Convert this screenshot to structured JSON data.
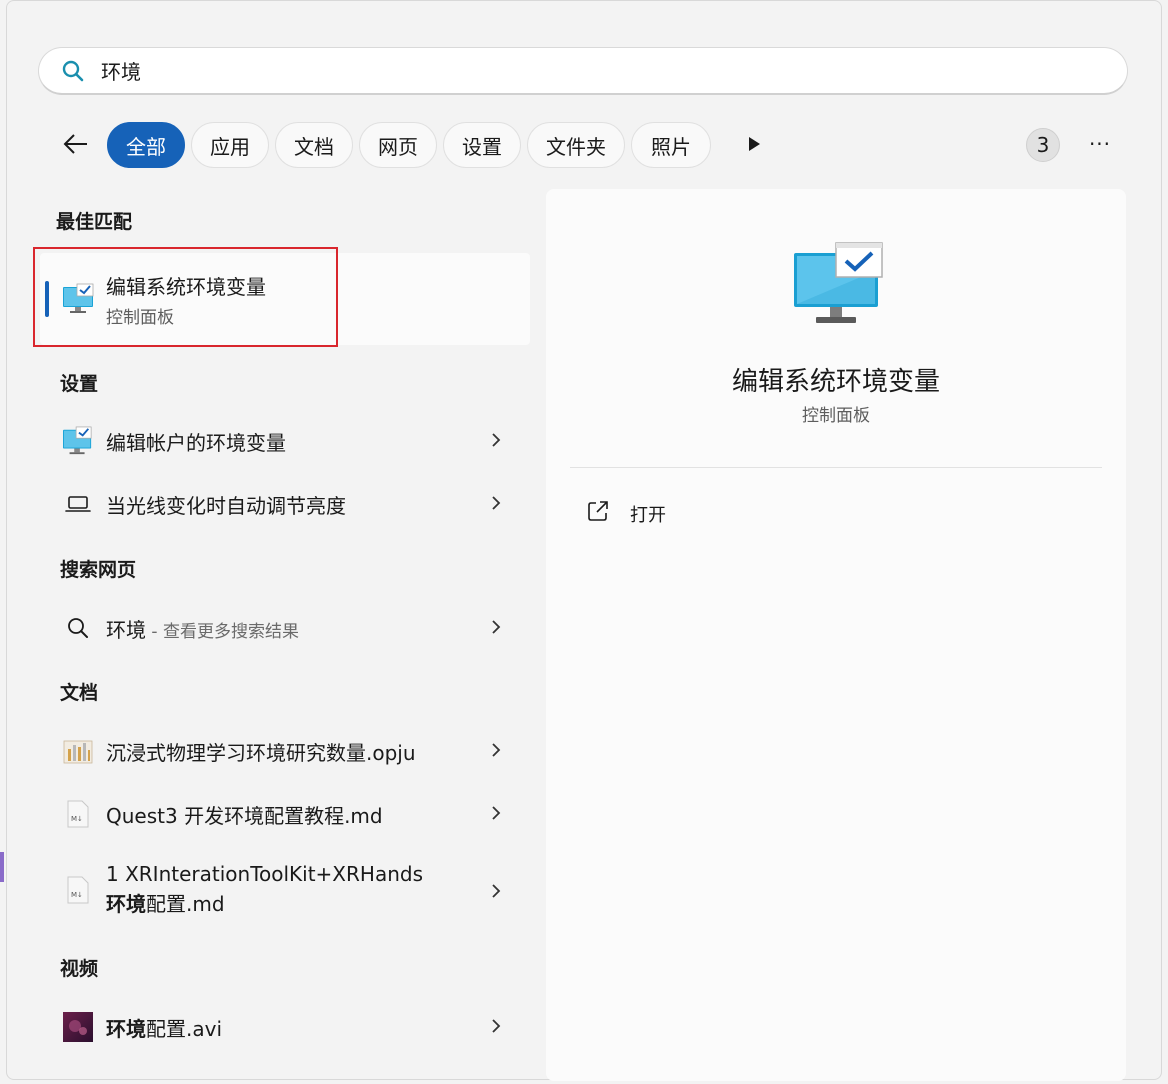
{
  "search": {
    "value": "环境"
  },
  "filters": {
    "tabs": [
      {
        "label": "全部",
        "active": true
      },
      {
        "label": "应用"
      },
      {
        "label": "文档"
      },
      {
        "label": "网页"
      },
      {
        "label": "设置"
      },
      {
        "label": "文件夹"
      },
      {
        "label": "照片"
      }
    ],
    "count": "3",
    "more_label": "···"
  },
  "sections": {
    "best_match": "最佳匹配",
    "settings": "设置",
    "web": "搜索网页",
    "documents": "文档",
    "videos": "视频"
  },
  "best_match": {
    "title": "编辑系统环境变量",
    "subtitle": "控制面板"
  },
  "settings_items": [
    {
      "label": "编辑帐户的环境变量",
      "icon": "monitor-check-icon"
    },
    {
      "label": "当光线变化时自动调节亮度",
      "icon": "laptop-icon"
    }
  ],
  "web_item": {
    "query": "环境",
    "hint": " - 查看更多搜索结果"
  },
  "document_items": [
    {
      "label": "沉浸式物理学习环境研究数量.opju",
      "icon": "origin-project-icon"
    },
    {
      "label": "Quest3 开发环境配置教程.md",
      "icon": "markdown-file-icon"
    },
    {
      "line1": "1 XRInterationToolKit+XRHands",
      "line2_bold": "环境",
      "line2_rest": "配置.md",
      "icon": "markdown-file-icon"
    }
  ],
  "video_item": {
    "bold": "环境",
    "rest": "配置.avi",
    "icon": "video-thumbnail-icon"
  },
  "detail": {
    "title": "编辑系统环境变量",
    "subtitle": "控制面板",
    "open_label": "打开"
  },
  "colors": {
    "accent": "#1662b8",
    "highlight_box": "#d9262d",
    "monitor": "#1aa3d6"
  }
}
